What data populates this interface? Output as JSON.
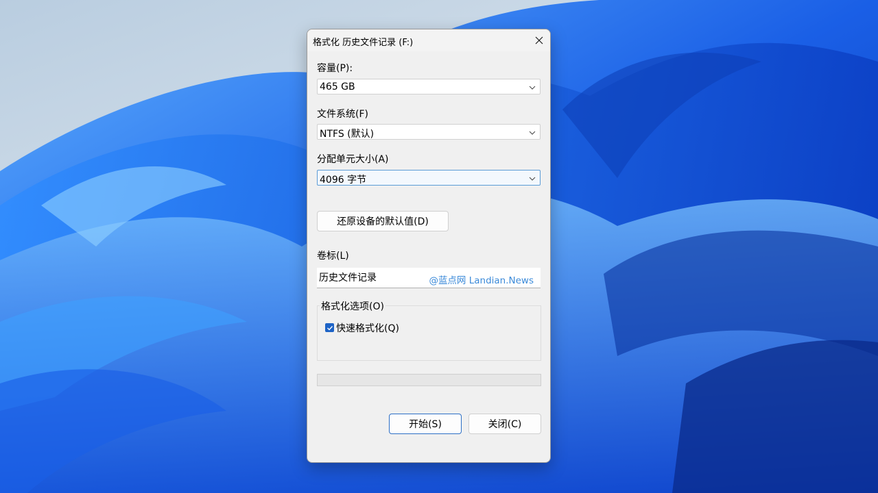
{
  "dialog": {
    "title": "格式化 历史文件记录 (F:)",
    "capacity": {
      "label": "容量(P):",
      "value": "465 GB"
    },
    "filesystem": {
      "label": "文件系统(F)",
      "value": "NTFS (默认)"
    },
    "allocation": {
      "label": "分配单元大小(A)",
      "value": "4096 字节"
    },
    "restore_defaults_label": "还原设备的默认值(D)",
    "volume": {
      "label": "卷标(L)",
      "value": "历史文件记录",
      "watermark": "@蓝点网 Landian.News"
    },
    "options": {
      "label": "格式化选项(O)",
      "quick_format_label": "快速格式化(Q)",
      "quick_format_checked": true
    },
    "progress": 0,
    "start_label": "开始(S)",
    "close_label": "关闭(C)"
  },
  "colors": {
    "accent": "#1d63c6",
    "watermark": "#3b8ad9",
    "dialog_bg": "#f0f0f0"
  }
}
